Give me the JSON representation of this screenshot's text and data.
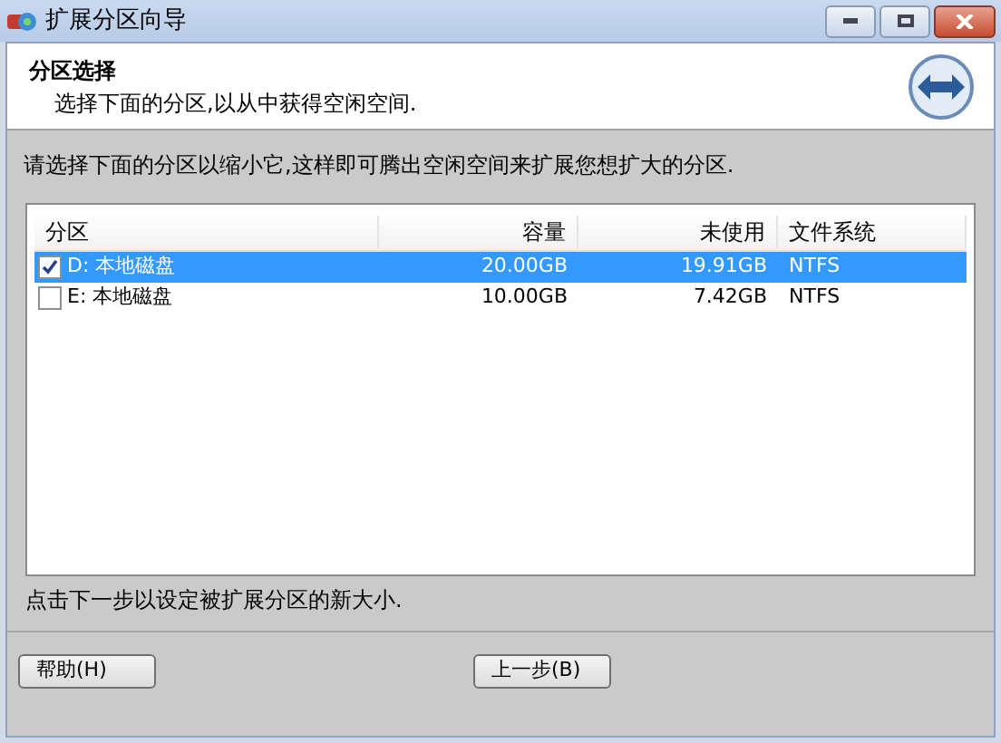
{
  "window": {
    "title": "扩展分区向导"
  },
  "header": {
    "title": "分区选择",
    "subtitle": "选择下面的分区,以从中获得空闲空间."
  },
  "instruction": "请选择下面的分区以缩小它,这样即可腾出空闲空间来扩展您想扩大的分区.",
  "table": {
    "columns": [
      "分区",
      "容量",
      "未使用",
      "文件系统"
    ],
    "rows": [
      {
        "cells": [
          "D: 本地磁盘",
          "20.00GB",
          "19.91GB",
          "NTFS"
        ],
        "checked": true,
        "selected": true
      },
      {
        "cells": [
          "E: 本地磁盘",
          "10.00GB",
          "7.42GB",
          "NTFS"
        ],
        "checked": false,
        "selected": false
      }
    ]
  },
  "hint": "点击下一步以设定被扩展分区的新大小.",
  "buttons": [
    "帮助(H)",
    "上一步(B)"
  ]
}
